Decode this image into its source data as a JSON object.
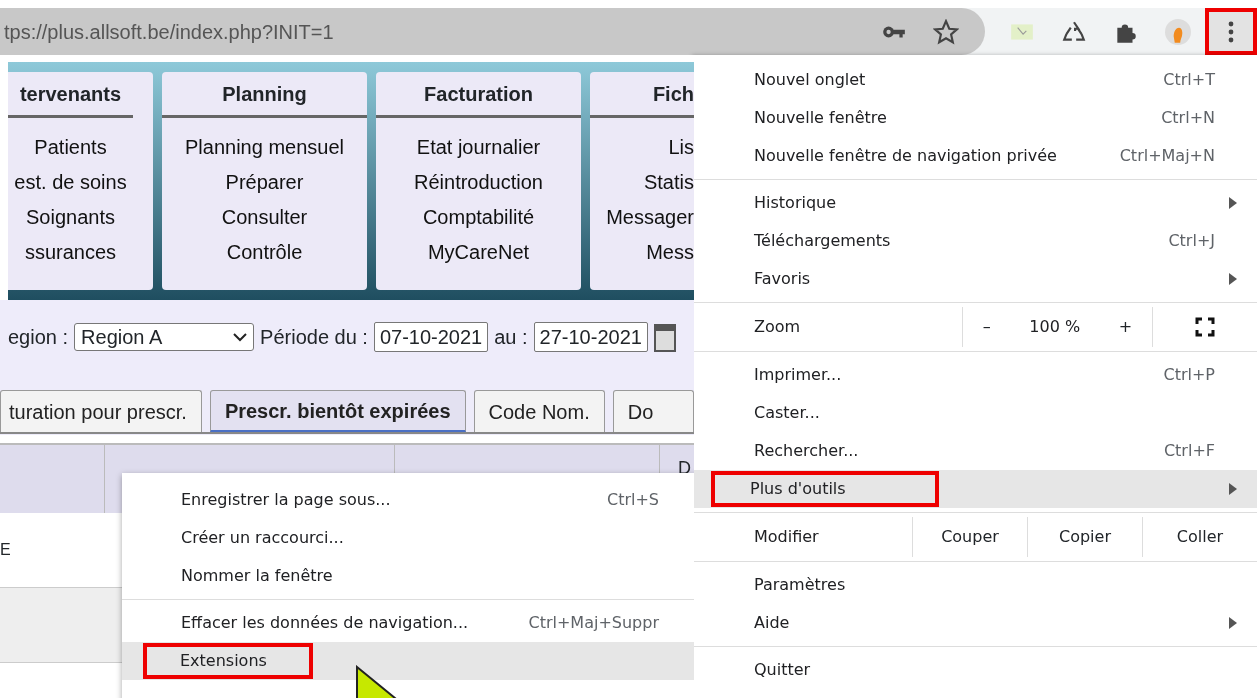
{
  "address_bar": {
    "url": "tps://plus.allsoft.be/index.php?INIT=1"
  },
  "toolbar": {
    "menu_annotated": true
  },
  "nav_cards": [
    {
      "title": "tervenants",
      "items": [
        "Patients",
        "est. de soins",
        "Soignants",
        "ssurances"
      ]
    },
    {
      "title": "Planning",
      "items": [
        "Planning mensuel",
        "Préparer",
        "Consulter",
        "Contrôle"
      ]
    },
    {
      "title": "Facturation",
      "items": [
        "Etat journalier",
        "Réintroduction",
        "Comptabilité",
        "MyCareNet"
      ]
    },
    {
      "title": "Fich",
      "items": [
        "Lis",
        "Statis",
        "Messager",
        "Mess"
      ]
    }
  ],
  "filter": {
    "region_label": "egion :",
    "region_value": "Region A",
    "period_label": "Période du :",
    "from": "07-10-2021",
    "to_label": "au :",
    "to": "27-10-2021"
  },
  "tabs": [
    {
      "label": "turation pour prescr.",
      "selected": false
    },
    {
      "label": "Prescr. bientôt expirées",
      "selected": true
    },
    {
      "label": "Code Nom.",
      "selected": false
    },
    {
      "label": "Do",
      "selected": false
    }
  ],
  "table": {
    "header_text": "D",
    "rows": [
      {
        "cells": [
          "E"
        ]
      },
      {
        "cells": []
      }
    ]
  },
  "chrome_menu": {
    "items": [
      {
        "kind": "item",
        "label": "Nouvel onglet",
        "shortcut": "Ctrl+T",
        "submenu": false,
        "highlighted": false,
        "annotated": false
      },
      {
        "kind": "item",
        "label": "Nouvelle fenêtre",
        "shortcut": "Ctrl+N",
        "submenu": false,
        "highlighted": false,
        "annotated": false
      },
      {
        "kind": "item",
        "label": "Nouvelle fenêtre de navigation privée",
        "shortcut": "Ctrl+Maj+N",
        "submenu": false,
        "highlighted": false,
        "annotated": false
      },
      {
        "kind": "separator"
      },
      {
        "kind": "item",
        "label": "Historique",
        "submenu": true,
        "highlighted": false,
        "annotated": false
      },
      {
        "kind": "item",
        "label": "Téléchargements",
        "shortcut": "Ctrl+J",
        "submenu": false,
        "highlighted": false,
        "annotated": false
      },
      {
        "kind": "item",
        "label": "Favoris",
        "submenu": true,
        "highlighted": false,
        "annotated": false
      },
      {
        "kind": "separator"
      },
      {
        "kind": "zoom",
        "label": "Zoom",
        "minus": "–",
        "value": "100 %",
        "plus": "+"
      },
      {
        "kind": "separator"
      },
      {
        "kind": "item",
        "label": "Imprimer...",
        "shortcut": "Ctrl+P",
        "submenu": false,
        "highlighted": false,
        "annotated": false
      },
      {
        "kind": "item",
        "label": "Caster...",
        "submenu": false,
        "highlighted": false,
        "annotated": false
      },
      {
        "kind": "item",
        "label": "Rechercher...",
        "shortcut": "Ctrl+F",
        "submenu": false,
        "highlighted": false,
        "annotated": false
      },
      {
        "kind": "item",
        "label": "Plus d'outils",
        "submenu": true,
        "highlighted": true,
        "annotated": true
      },
      {
        "kind": "separator"
      },
      {
        "kind": "edit",
        "label": "Modifier",
        "buttons": [
          "Couper",
          "Copier",
          "Coller"
        ]
      },
      {
        "kind": "separator"
      },
      {
        "kind": "item",
        "label": "Paramètres",
        "submenu": false,
        "highlighted": false,
        "annotated": false
      },
      {
        "kind": "item",
        "label": "Aide",
        "submenu": true,
        "highlighted": false,
        "annotated": false
      },
      {
        "kind": "separator"
      },
      {
        "kind": "item",
        "label": "Quitter",
        "submenu": false,
        "highlighted": false,
        "annotated": false
      }
    ]
  },
  "submenu": {
    "items": [
      {
        "kind": "item",
        "label": "Enregistrer la page sous...",
        "shortcut": "Ctrl+S",
        "highlighted": false,
        "annotated": false
      },
      {
        "kind": "item",
        "label": "Créer un raccourci...",
        "highlighted": false,
        "annotated": false
      },
      {
        "kind": "item",
        "label": "Nommer la fenêtre",
        "highlighted": false,
        "annotated": false
      },
      {
        "kind": "separator"
      },
      {
        "kind": "item",
        "label": "Effacer les données de navigation...",
        "shortcut": "Ctrl+Maj+Suppr",
        "highlighted": false,
        "annotated": false
      },
      {
        "kind": "item",
        "label": "Extensions",
        "highlighted": true,
        "annotated": true
      }
    ]
  }
}
